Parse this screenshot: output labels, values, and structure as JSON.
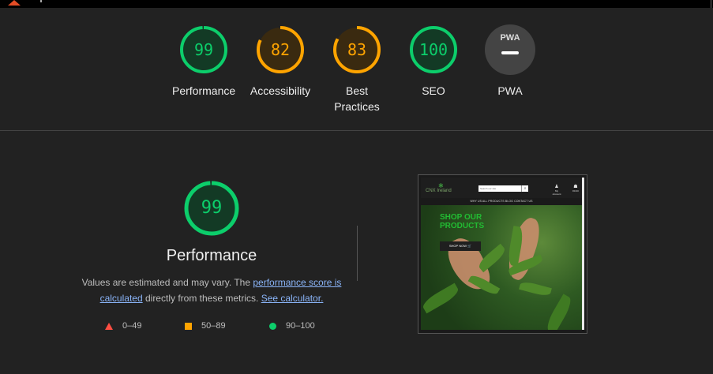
{
  "scores": [
    {
      "id": "performance",
      "value": "99",
      "fraction": 0.99,
      "label": "Performance",
      "color": "#0cce6b",
      "bg": "#133a25"
    },
    {
      "id": "accessibility",
      "value": "82",
      "fraction": 0.82,
      "label": "Accessibility",
      "color": "#ffa400",
      "bg": "#3a2a10"
    },
    {
      "id": "best-practices",
      "value": "83",
      "fraction": 0.83,
      "label": "Best Practices",
      "color": "#ffa400",
      "bg": "#3a2a10"
    },
    {
      "id": "seo",
      "value": "100",
      "fraction": 1.0,
      "label": "SEO",
      "color": "#0cce6b",
      "bg": "#133a25"
    },
    {
      "id": "pwa",
      "value": "PWA",
      "label": "PWA",
      "color": "#dddddd",
      "bg": "#444444"
    }
  ],
  "detail": {
    "score": "99",
    "title": "Performance",
    "desc_prefix": "Values are estimated and may vary. The ",
    "link_score": "performance score is calculated",
    "desc_middle": " directly from these metrics. ",
    "link_calc": "See calculator."
  },
  "legend": [
    {
      "range": "0–49",
      "shape": "triangle",
      "color": "#ff4e42"
    },
    {
      "range": "50–89",
      "shape": "square",
      "color": "#ffa400"
    },
    {
      "range": "90–100",
      "shape": "circle",
      "color": "#0cce6b"
    }
  ],
  "screenshot": {
    "logo": "CNX Ireland",
    "search_placeholder": "Search our site",
    "nav": "WHY US   ALL PRODUCTS   BLOG   CONTACT US",
    "account": "My Account",
    "cart": "€0.00",
    "hero_title": "SHOP OUR PRODUCTS",
    "hero_button": "SHOP NOW 🛒"
  }
}
